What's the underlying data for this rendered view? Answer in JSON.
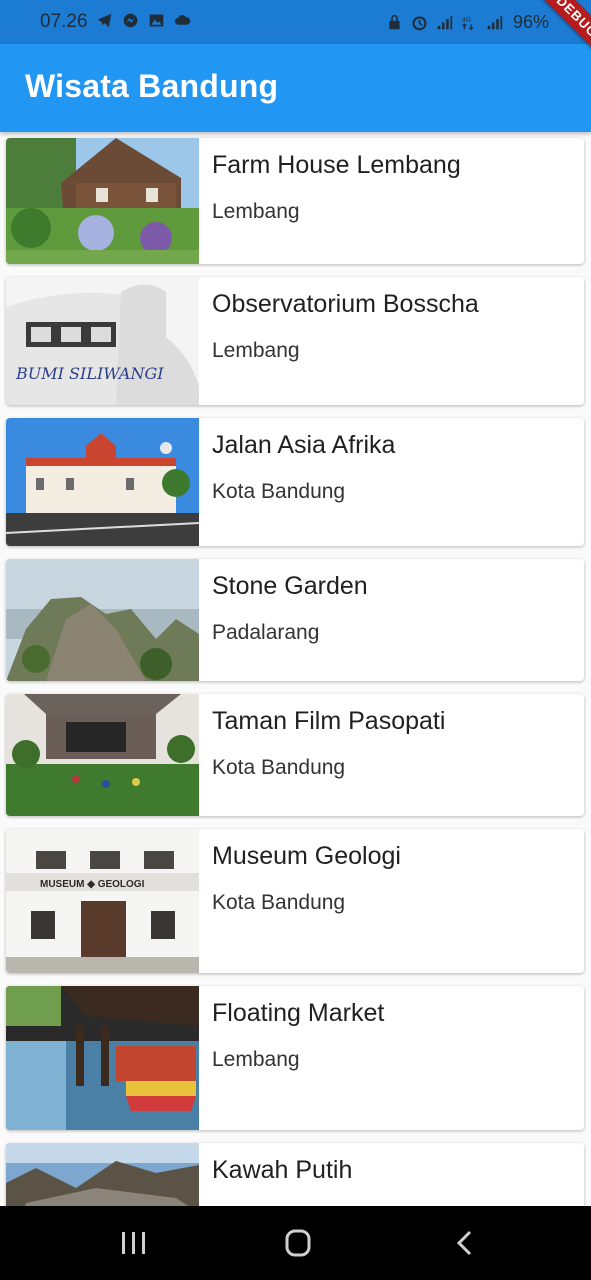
{
  "status_bar": {
    "time": "07.26",
    "battery": "96%",
    "left_icons": [
      "telegram-icon",
      "messenger-icon",
      "gallery-icon",
      "cloud-icon"
    ],
    "right_icons": [
      "sim-lock-icon",
      "alarm-icon",
      "signal-icon",
      "4g-icon",
      "signal-icon",
      "battery-icon"
    ]
  },
  "app_bar": {
    "title": "Wisata Bandung",
    "color": "#2196f3"
  },
  "debug_banner": "DEBUG",
  "places": [
    {
      "name": "Farm House Lembang",
      "location": "Lembang"
    },
    {
      "name": "Observatorium Bosscha",
      "location": "Lembang",
      "image_text": "BUMI SILIWANGI"
    },
    {
      "name": "Jalan Asia Afrika",
      "location": "Kota Bandung"
    },
    {
      "name": "Stone Garden",
      "location": "Padalarang"
    },
    {
      "name": "Taman Film Pasopati",
      "location": "Kota Bandung"
    },
    {
      "name": "Museum Geologi",
      "location": "Kota Bandung",
      "image_text": "MUSEUM ◆ GEOLOGI"
    },
    {
      "name": "Floating Market",
      "location": "Lembang"
    },
    {
      "name": "Kawah Putih",
      "location": ""
    }
  ],
  "nav_bar": {
    "buttons": [
      "recents-icon",
      "home-icon",
      "back-icon"
    ]
  }
}
